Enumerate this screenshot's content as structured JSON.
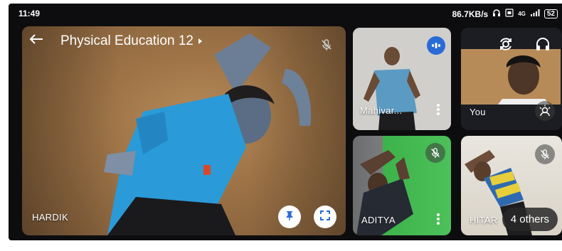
{
  "status_bar": {
    "time": "11:49",
    "network_speed": "86.7KB/s",
    "network_type": "4G",
    "battery": "52"
  },
  "meeting": {
    "title": "Physical Education 12"
  },
  "tiles": {
    "main": {
      "name": "HARDIK"
    },
    "mahivar": {
      "name": "Mahivar..."
    },
    "self": {
      "name": "You"
    },
    "aditya": {
      "name": "ADITYA"
    },
    "hitar": {
      "name": "HITAR"
    }
  },
  "others_label": "4 others",
  "colors": {
    "accent_blue": "#2b6bd6",
    "background": "#0d0d0f"
  }
}
